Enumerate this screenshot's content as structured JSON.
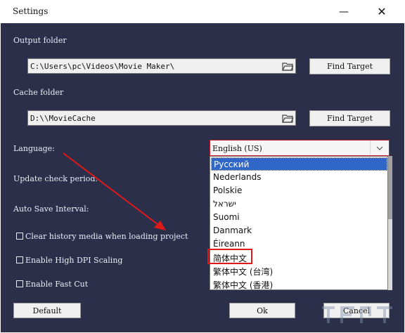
{
  "window": {
    "title": "Settings",
    "minimize_glyph": "—",
    "close_glyph": "✕"
  },
  "output": {
    "label": "Output folder",
    "value": "C:\\Users\\pc\\Videos\\Movie Maker\\",
    "find_label": "Find Target"
  },
  "cache": {
    "label": "Cache folder",
    "value": "D:\\\\MovieCache",
    "find_label": "Find Target"
  },
  "language": {
    "label": "Language:",
    "selected": "English (US)",
    "options": [
      "Русский",
      "Nederlands",
      "Polskie",
      "ישראל",
      "Suomi",
      "Danmark",
      "Éireann",
      "简体中文",
      "繁体中文 (台湾)",
      "繁体中文 (香港)"
    ],
    "highlighted_index": 0,
    "annotated_index": 7
  },
  "update": {
    "label": "Update check period:"
  },
  "autosave": {
    "label": "Auto Save Interval:"
  },
  "checks": {
    "clear_history": "Clear history media when loading project",
    "high_dpi": "Enable High DPI Scaling",
    "fast_cut": "Enable Fast Cut"
  },
  "footer": {
    "default_label": "Default",
    "ok_label": "Ok",
    "cancel_label": "Cancel"
  },
  "colors": {
    "background": "#2b2f4a",
    "selection": "#2f66c8",
    "annotation": "#e01818"
  }
}
